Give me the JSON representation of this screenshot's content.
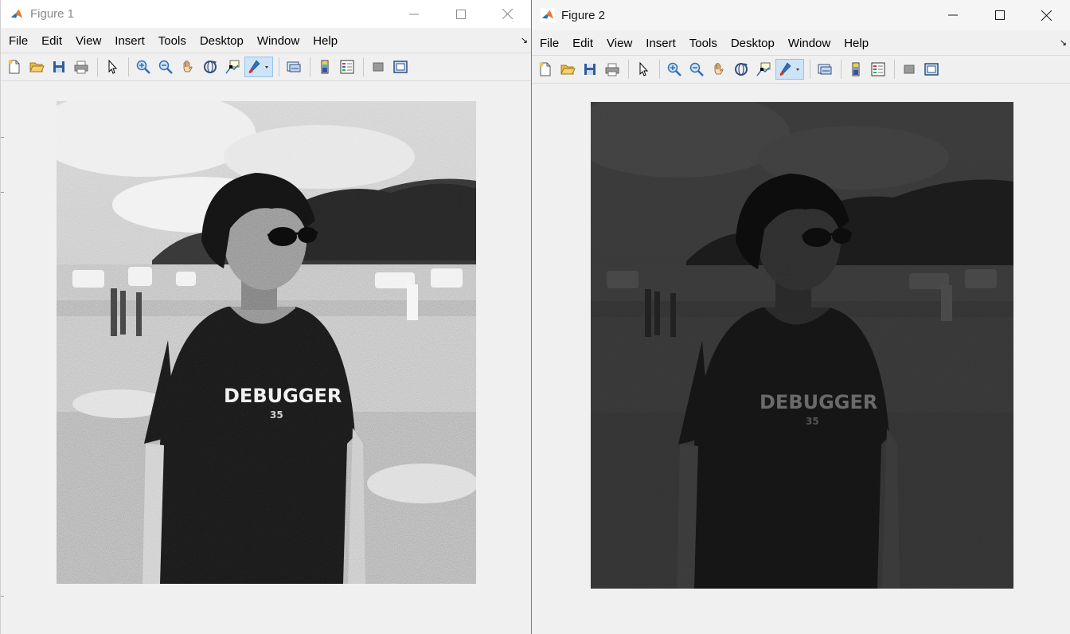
{
  "figures": [
    {
      "title": "Figure 1",
      "menu": [
        "File",
        "Edit",
        "View",
        "Insert",
        "Tools",
        "Desktop",
        "Window",
        "Help"
      ],
      "tshirt_text": "DEBUGGER",
      "tshirt_sub": "35",
      "image_tone": "noisy-grayscale"
    },
    {
      "title": "Figure 2",
      "menu": [
        "File",
        "Edit",
        "View",
        "Insert",
        "Tools",
        "Desktop",
        "Window",
        "Help"
      ],
      "tshirt_text": "DEBUGGER",
      "tshirt_sub": "35",
      "image_tone": "dark-grayscale"
    }
  ],
  "toolbar_icons": [
    "new-figure-icon",
    "open-file-icon",
    "save-icon",
    "print-icon",
    "edit-plot-icon",
    "zoom-in-icon",
    "zoom-out-icon",
    "pan-icon",
    "rotate-3d-icon",
    "data-cursor-icon",
    "brush-icon",
    "link-plot-icon",
    "insert-colorbar-icon",
    "insert-legend-icon",
    "hide-plot-tools-icon",
    "show-plot-tools-icon"
  ],
  "menu_dock_glyph": "↘",
  "colors": {
    "fig1_titlebar": "#ffffff",
    "fig2_titlebar": "#f5f5f5",
    "background": "#f0f0f0",
    "matlab_orange": "#e8782a",
    "matlab_blue": "#2f6fb5"
  }
}
